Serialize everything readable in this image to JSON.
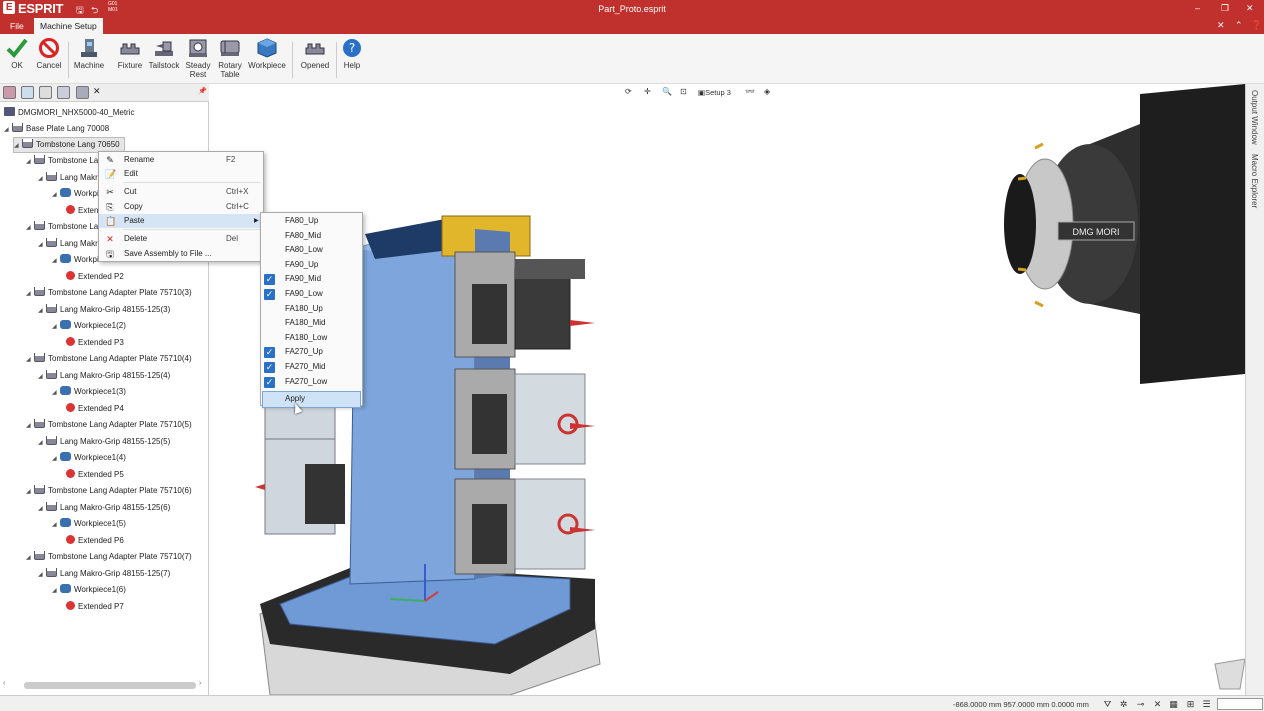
{
  "titlebar": {
    "app_name": "ESPRIT",
    "document_title": "Part_Proto.esprit",
    "qa_g01": "G01",
    "qa_m01": "M01"
  },
  "menubar": {
    "file": "File",
    "active_tab": "Machine Setup"
  },
  "ribbon": [
    {
      "name": "ok",
      "label": "OK",
      "icon": "check-icon"
    },
    {
      "name": "cancel",
      "label": "Cancel",
      "icon": "no-icon"
    },
    {
      "name": "machine",
      "label": "Machine",
      "icon": "machine-icon"
    },
    {
      "name": "fixture",
      "label": "Fixture",
      "icon": "fixture-icon"
    },
    {
      "name": "tailstock",
      "label": "Tailstock",
      "icon": "tailstock-icon"
    },
    {
      "name": "steady-rest",
      "label": "Steady\nRest",
      "icon": "steady-rest-icon"
    },
    {
      "name": "rotary-table",
      "label": "Rotary\nTable",
      "icon": "rotary-table-icon"
    },
    {
      "name": "workpiece",
      "label": "Workpiece",
      "icon": "workpiece-icon"
    },
    {
      "name": "opened",
      "label": "Opened",
      "icon": "opened-icon"
    },
    {
      "name": "help",
      "label": "Help",
      "icon": "help-icon"
    }
  ],
  "tree": [
    {
      "label": "DMGMORI_NHX5000-40_Metric",
      "level": 0,
      "icon": "machine",
      "arrow": ""
    },
    {
      "label": "Base Plate Lang 70008",
      "level": 0,
      "icon": "fixture",
      "arrow": "◢"
    },
    {
      "label": "Tombstone Lang 70650",
      "level": 1,
      "icon": "fixture",
      "arrow": "◢",
      "selected": true
    },
    {
      "label": "Tombstone Lang Adapter Plate 75710(1)",
      "level": 2,
      "icon": "fixture",
      "arrow": "◢"
    },
    {
      "label": "Lang Makro-Grip 48155-125(1)",
      "level": 3,
      "icon": "fixture",
      "arrow": "◢"
    },
    {
      "label": "Workpiece1",
      "level": 4,
      "icon": "workpiece",
      "arrow": "◢"
    },
    {
      "label": "Extended P1",
      "level": 5,
      "icon": "extended",
      "arrow": ""
    },
    {
      "label": "Tombstone Lang Adapter Plate 75710(2)",
      "level": 2,
      "icon": "fixture",
      "arrow": "◢"
    },
    {
      "label": "Lang Makro-Grip 48155-125(2)",
      "level": 3,
      "icon": "fixture",
      "arrow": "◢"
    },
    {
      "label": "Workpiece2",
      "level": 4,
      "icon": "workpiece",
      "arrow": "◢"
    },
    {
      "label": "Extended P2",
      "level": 5,
      "icon": "extended",
      "arrow": ""
    },
    {
      "label": "Tombstone Lang Adapter Plate 75710(3)",
      "level": 2,
      "icon": "fixture",
      "arrow": "◢"
    },
    {
      "label": "Lang Makro-Grip 48155-125(3)",
      "level": 3,
      "icon": "fixture",
      "arrow": "◢"
    },
    {
      "label": "Workpiece1(2)",
      "level": 4,
      "icon": "workpiece",
      "arrow": "◢"
    },
    {
      "label": "Extended P3",
      "level": 5,
      "icon": "extended",
      "arrow": ""
    },
    {
      "label": "Tombstone Lang Adapter Plate 75710(4)",
      "level": 2,
      "icon": "fixture",
      "arrow": "◢"
    },
    {
      "label": "Lang Makro-Grip 48155-125(4)",
      "level": 3,
      "icon": "fixture",
      "arrow": "◢"
    },
    {
      "label": "Workpiece1(3)",
      "level": 4,
      "icon": "workpiece",
      "arrow": "◢"
    },
    {
      "label": "Extended P4",
      "level": 5,
      "icon": "extended",
      "arrow": ""
    },
    {
      "label": "Tombstone Lang Adapter Plate 75710(5)",
      "level": 2,
      "icon": "fixture",
      "arrow": "◢"
    },
    {
      "label": "Lang Makro-Grip 48155-125(5)",
      "level": 3,
      "icon": "fixture",
      "arrow": "◢"
    },
    {
      "label": "Workpiece1(4)",
      "level": 4,
      "icon": "workpiece",
      "arrow": "◢"
    },
    {
      "label": "Extended P5",
      "level": 5,
      "icon": "extended",
      "arrow": ""
    },
    {
      "label": "Tombstone Lang Adapter Plate 75710(6)",
      "level": 2,
      "icon": "fixture",
      "arrow": "◢"
    },
    {
      "label": "Lang Makro-Grip 48155-125(6)",
      "level": 3,
      "icon": "fixture",
      "arrow": "◢"
    },
    {
      "label": "Workpiece1(5)",
      "level": 4,
      "icon": "workpiece",
      "arrow": "◢"
    },
    {
      "label": "Extended P6",
      "level": 5,
      "icon": "extended",
      "arrow": ""
    },
    {
      "label": "Tombstone Lang Adapter Plate 75710(7)",
      "level": 2,
      "icon": "fixture",
      "arrow": "◢"
    },
    {
      "label": "Lang Makro-Grip 48155-125(7)",
      "level": 3,
      "icon": "fixture",
      "arrow": "◢"
    },
    {
      "label": "Workpiece1(6)",
      "level": 4,
      "icon": "workpiece",
      "arrow": "◢"
    },
    {
      "label": "Extended P7",
      "level": 5,
      "icon": "extended",
      "arrow": ""
    }
  ],
  "context_menu": [
    {
      "label": "Rename",
      "shortcut": "F2",
      "icon": "rename-icon"
    },
    {
      "label": "Edit",
      "shortcut": "",
      "icon": "edit-icon"
    },
    {
      "label": "Cut",
      "shortcut": "Ctrl+X",
      "icon": "scissors-icon"
    },
    {
      "label": "Copy",
      "shortcut": "Ctrl+C",
      "icon": "copy-icon"
    },
    {
      "label": "Paste",
      "shortcut": "",
      "icon": "paste-icon",
      "submenu": true,
      "highlighted": true
    },
    {
      "label": "Delete",
      "shortcut": "Del",
      "icon": "delete-icon"
    },
    {
      "label": "Save Assembly to File ...",
      "shortcut": "",
      "icon": "save-icon"
    }
  ],
  "paste_submenu": [
    {
      "label": "FA80_Up",
      "checked": false
    },
    {
      "label": "FA80_Mid",
      "checked": false
    },
    {
      "label": "FA80_Low",
      "checked": false
    },
    {
      "label": "FA90_Up",
      "checked": false
    },
    {
      "label": "FA90_Mid",
      "checked": true
    },
    {
      "label": "FA90_Low",
      "checked": true
    },
    {
      "label": "FA180_Up",
      "checked": false
    },
    {
      "label": "FA180_Mid",
      "checked": false
    },
    {
      "label": "FA180_Low",
      "checked": false
    },
    {
      "label": "FA270_Up",
      "checked": true
    },
    {
      "label": "FA270_Mid",
      "checked": true
    },
    {
      "label": "FA270_Low",
      "checked": true
    }
  ],
  "apply_label": "Apply",
  "viewport_toolbar": {
    "setup_label": "Setup 3"
  },
  "right_dock": {
    "output_window": "Output Window",
    "macro_explorer": "Macro Explorer"
  },
  "spindle_brand": "DMG MORI",
  "statusbar": {
    "coords": "-868.0000 mm  957.0000 mm  0.0000 mm"
  },
  "colors": {
    "brand_red": "#c0302d",
    "accent_blue": "#2a70c8",
    "part_blue": "#6f9ad6"
  }
}
